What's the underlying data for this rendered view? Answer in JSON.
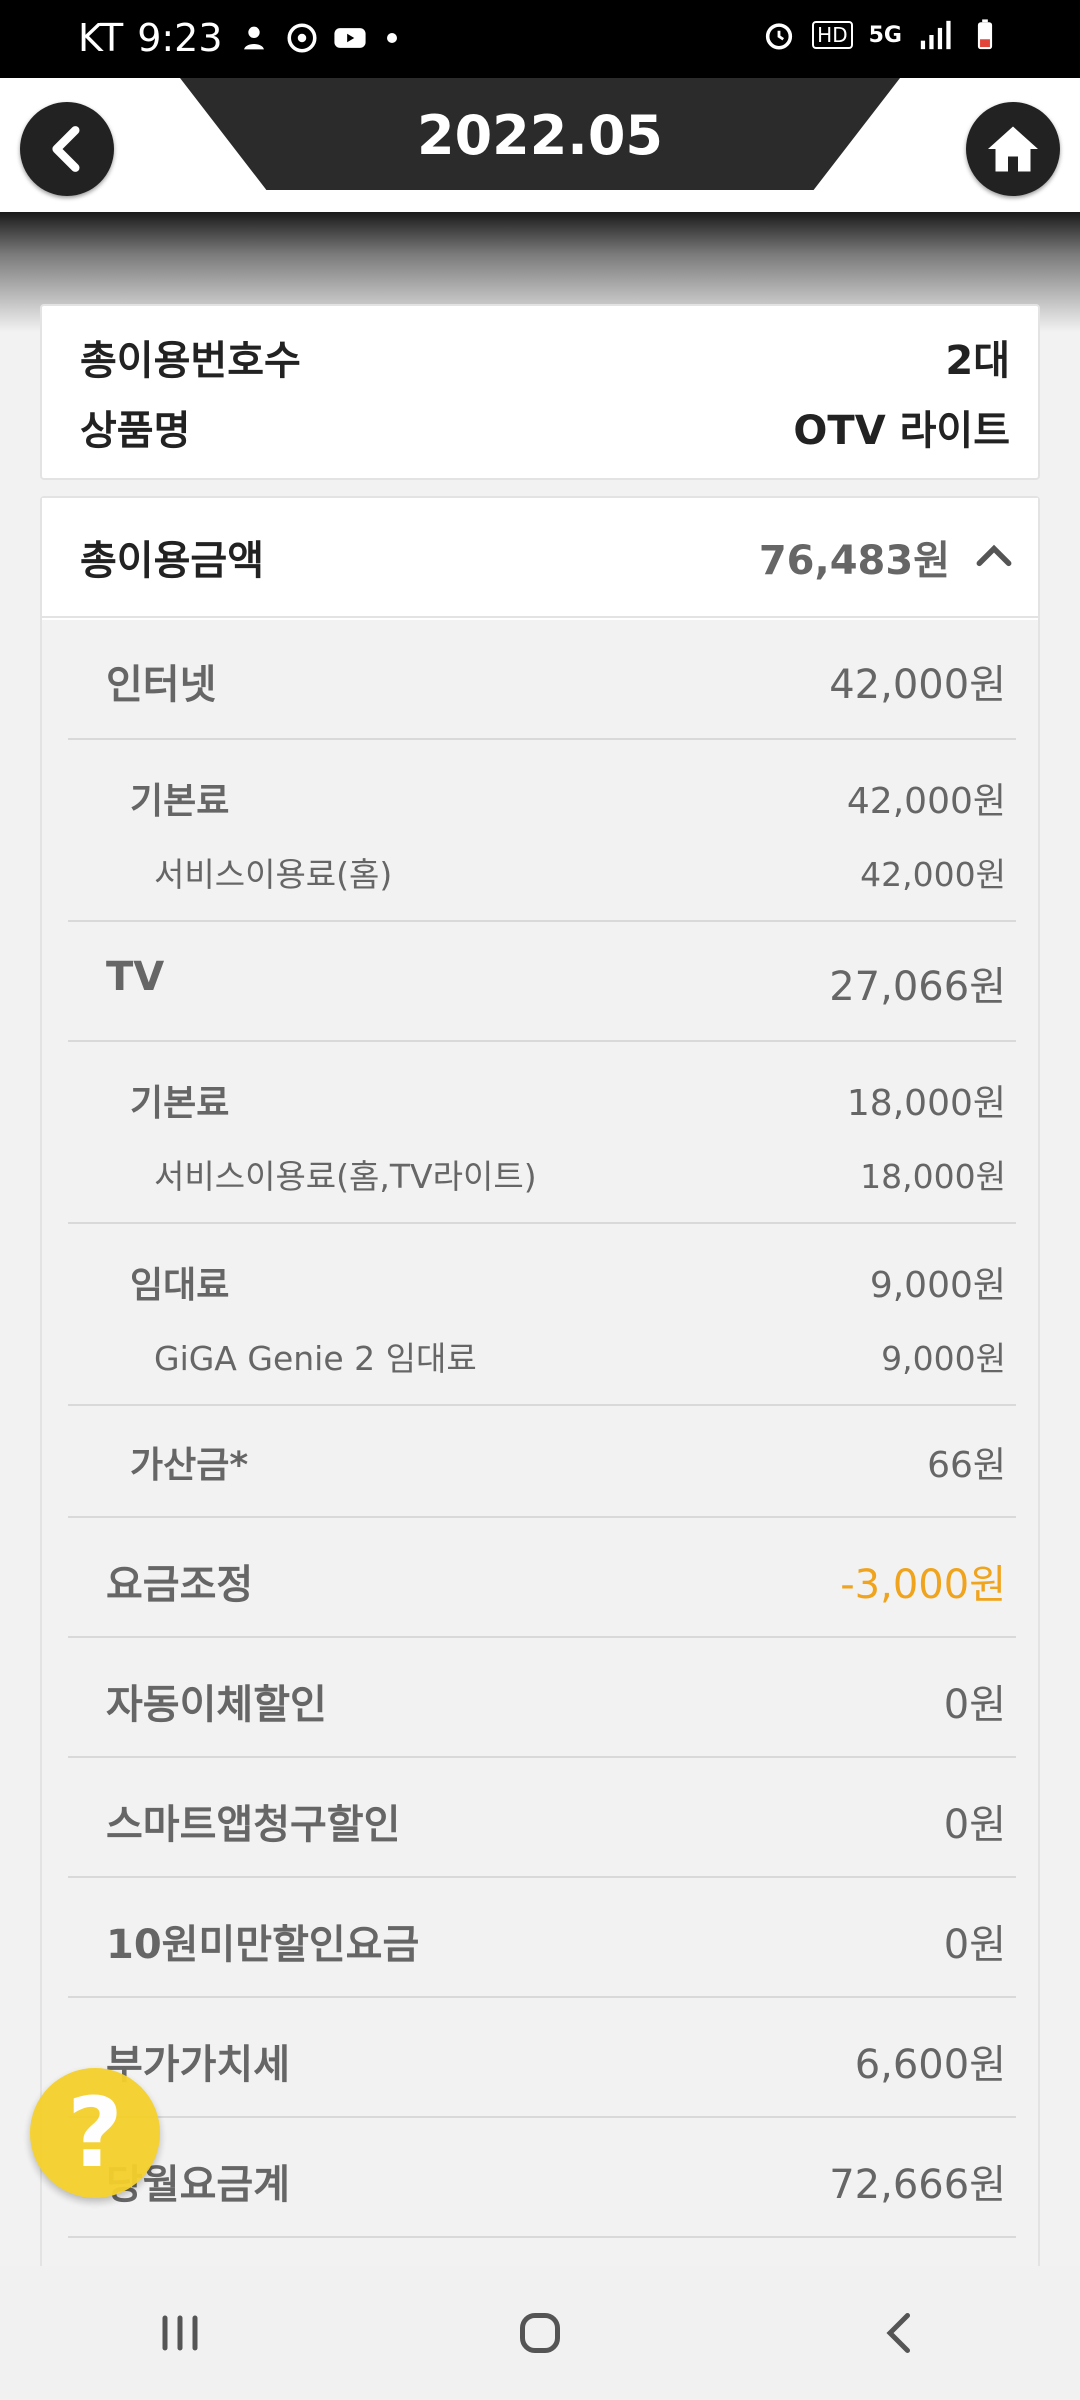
{
  "status_bar": {
    "carrier": "KT",
    "time": "9:23",
    "network": "5G",
    "hd": "HD"
  },
  "header": {
    "title": "2022.05"
  },
  "summary": {
    "rows": [
      {
        "label": "총이용번호수",
        "value": "2대"
      },
      {
        "label": "상품명",
        "value": "OTV 라이트"
      }
    ]
  },
  "total": {
    "label": "총이용금액",
    "value": "76,483원"
  },
  "details": [
    {
      "label": "인터넷",
      "value": "42,000원"
    },
    {
      "label": "기본료",
      "value": "42,000원"
    },
    {
      "label": "서비스이용료(홈)",
      "value": "42,000원"
    },
    {
      "label": "TV",
      "value": "27,066원"
    },
    {
      "label": "기본료",
      "value": "18,000원"
    },
    {
      "label": "서비스이용료(홈,TV라이트)",
      "value": "18,000원"
    },
    {
      "label": "임대료",
      "value": "9,000원"
    },
    {
      "label": "GiGA Genie 2 임대료",
      "value": "9,000원"
    },
    {
      "label": "가산금*",
      "value": "66원"
    },
    {
      "label": "요금조정",
      "value": "-3,000원"
    },
    {
      "label": "자동이체할인",
      "value": "0원"
    },
    {
      "label": "스마트앱청구할인",
      "value": "0원"
    },
    {
      "label": "10원미만할인요금",
      "value": "0원"
    },
    {
      "label": "부가가치세",
      "value": "6,600원"
    },
    {
      "label": "당월요금계",
      "value": "72,666원"
    }
  ],
  "help_button": {
    "label": "?"
  },
  "colors": {
    "accent_negative": "#f0a31c",
    "header_dark": "#2b2b2b",
    "help_yellow": "#f5d02a"
  }
}
